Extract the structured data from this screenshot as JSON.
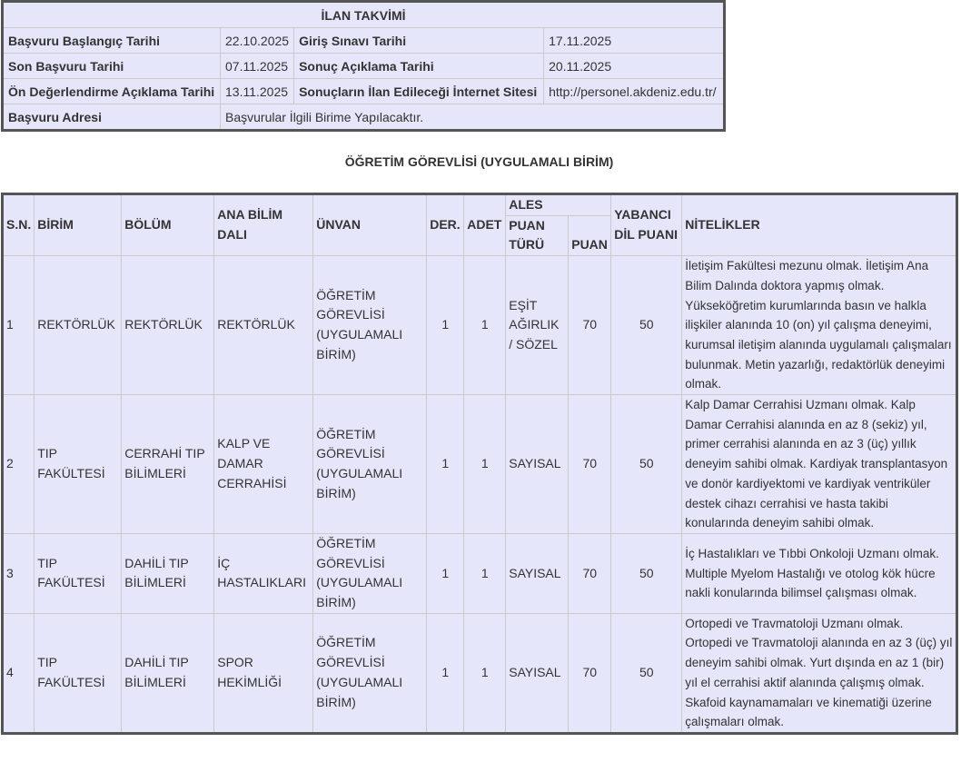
{
  "calendar": {
    "title": "İLAN TAKVİMİ",
    "rows": [
      {
        "k1": "Başvuru Başlangıç Tarihi",
        "v1": "22.10.2025",
        "k2": "Giriş Sınavı Tarihi",
        "v2": "17.11.2025"
      },
      {
        "k1": "Son Başvuru Tarihi",
        "v1": "07.11.2025",
        "k2": "Sonuç Açıklama Tarihi",
        "v2": "20.11.2025"
      },
      {
        "k1": "Ön Değerlendirme Açıklama Tarihi",
        "v1": "13.11.2025",
        "k2": "Sonuçların İlan Edileceği İnternet Sitesi",
        "v2": "http://personel.akdeniz.edu.tr/"
      }
    ],
    "address_label": "Başvuru Adresi",
    "address_value": "Başvurular İlgili Birime Yapılacaktır."
  },
  "heading": "ÖĞRETİM GÖREVLİSİ (UYGULAMALI BİRİM)",
  "jobs": {
    "headers": {
      "sn": "S.N.",
      "birim": "BİRİM",
      "bolum": "BÖLÜM",
      "anabilim": "ANA BİLİM DALI",
      "unvan": "ÜNVAN",
      "der": "DER.",
      "adet": "ADET",
      "ales": "ALES",
      "puan_turu": "PUAN TÜRÜ",
      "puan": "PUAN",
      "yabanci": "YABANCI DİL PUANI",
      "nitelikler": "NİTELİKLER"
    },
    "rows": [
      {
        "sn": "1",
        "birim": "REKTÖRLÜK",
        "bolum": "REKTÖRLÜK",
        "anabilim": "REKTÖRLÜK",
        "unvan": "ÖĞRETİM GÖREVLİSİ (UYGULAMALI BİRİM)",
        "der": "1",
        "adet": "1",
        "puan_turu": "EŞİT AĞIRLIK / SÖZEL",
        "puan": "70",
        "yabanci": "50",
        "nitelikler": "İletişim Fakültesi mezunu olmak. İletişim Ana Bilim Dalında doktora yapmış olmak. Yükseköğretim kurumlarında basın ve halkla ilişkiler alanında 10 (on) yıl çalışma deneyimi, kurumsal iletişim alanında uygulamalı çalışmaları bulunmak. Metin yazarlığı, redaktörlük deneyimi olmak."
      },
      {
        "sn": "2",
        "birim": "TIP FAKÜLTESİ",
        "bolum": "CERRAHİ TIP BİLİMLERİ",
        "anabilim": "KALP VE DAMAR CERRAHİSİ",
        "unvan": "ÖĞRETİM GÖREVLİSİ (UYGULAMALI BİRİM)",
        "der": "1",
        "adet": "1",
        "puan_turu": "SAYISAL",
        "puan": "70",
        "yabanci": "50",
        "nitelikler": "Kalp Damar Cerrahisi Uzmanı olmak. Kalp Damar Cerrahisi alanında en az 8 (sekiz) yıl, primer cerrahisi alanında en az 3 (üç) yıllık deneyim sahibi olmak. Kardiyak transplantasyon ve donör kardiyektomi ve kardiyak ventriküler destek cihazı cerrahisi ve hasta takibi konularında deneyim sahibi olmak."
      },
      {
        "sn": "3",
        "birim": "TIP FAKÜLTESİ",
        "bolum": "DAHİLİ TIP BİLİMLERİ",
        "anabilim": "İÇ HASTALIKLARI",
        "unvan": "ÖĞRETİM GÖREVLİSİ (UYGULAMALI BİRİM)",
        "der": "1",
        "adet": "1",
        "puan_turu": "SAYISAL",
        "puan": "70",
        "yabanci": "50",
        "nitelikler": "İç Hastalıkları ve Tıbbi Onkoloji Uzmanı olmak. Multiple Myelom Hastalığı ve otolog kök hücre nakli konularında bilimsel çalışması olmak."
      },
      {
        "sn": "4",
        "birim": "TIP FAKÜLTESİ",
        "bolum": "DAHİLİ TIP BİLİMLERİ",
        "anabilim": "SPOR HEKİMLİĞİ",
        "unvan": "ÖĞRETİM GÖREVLİSİ (UYGULAMALI BİRİM)",
        "der": "1",
        "adet": "1",
        "puan_turu": "SAYISAL",
        "puan": "70",
        "yabanci": "50",
        "nitelikler": "Ortopedi ve Travmatoloji Uzmanı olmak. Ortopedi ve Travmatoloji alanında en az 3 (üç) yıl deneyim sahibi olmak. Yurt dışında en az 1 (bir) yıl el cerrahisi aktif alanında çalışmış olmak. Skafoid kaynamamaları ve kinematiği üzerine çalışmaları olmak."
      }
    ]
  }
}
